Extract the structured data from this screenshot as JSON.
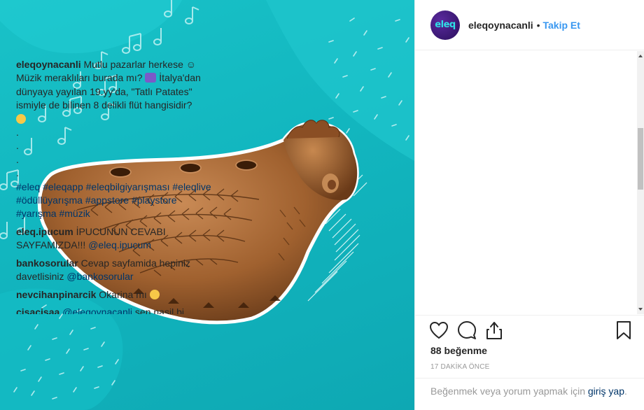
{
  "post": {
    "username": "eleqoynacanli",
    "avatar_text": "eleq",
    "follow_label": "Takip Et",
    "separator": "•"
  },
  "caption": {
    "username": "eleqoynacanli",
    "text_1": "Mutlu pazarlar herkese ☺ Müzik meraklıları burada mı?",
    "text_2": "İtalya'dan dünyaya yayılan 19.yy'da, \"Tatlı Patates\" ismiyle de bilinen 8 delikli flüt hangisidir?",
    "dots": [
      ".",
      ".",
      ".",
      "."
    ],
    "hashtags": "#eleq #eleqapp #eleqbilgiyarışması #eleqlive #ödüllüyarışma #appstore #playstore #yarışma #müzik"
  },
  "comments": [
    {
      "username": "eleq.ipucum",
      "text": "İPUCUNUN CEVABI SAYFAMIZDA!!! ",
      "mention": "@eleq.ipucum"
    },
    {
      "username": "bankosorular",
      "text": "Cevap sayfamida hepiniz davetlisiniz ",
      "mention": "@bankosorular"
    },
    {
      "username": "nevcihanpinarcik",
      "text": "Okarina mı ",
      "mention": ""
    },
    {
      "username": "cisacisaa",
      "text": " sen nasil bi kralsin?",
      "mention": "@eleqoynacanli"
    }
  ],
  "stats": {
    "likes": "88 beğenme",
    "time": "17 DAKİKA ÖNCE"
  },
  "login": {
    "prefix": "Beğenmek veya yorum yapmak için ",
    "link": "giriş yap",
    "suffix": "."
  },
  "icons": [
    "heart-icon",
    "comment-icon",
    "share-icon",
    "bookmark-icon"
  ],
  "colors": {
    "teal_background": "#12b6bf",
    "link": "#003569",
    "follow": "#3897f0",
    "ocarina": "#a0612f"
  }
}
